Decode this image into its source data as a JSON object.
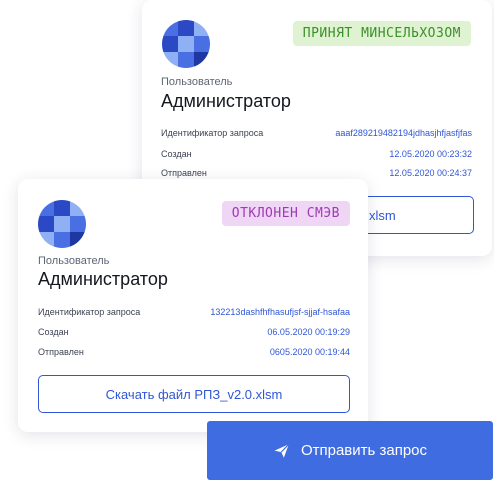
{
  "back_card": {
    "status_badge": "ПРИНЯТ МИНСЕЛЬХОЗОМ",
    "user_label": "Пользователь",
    "user_name": "Администратор",
    "rows": [
      {
        "label": "Идентификатор запроса",
        "value": "aaaf289219482194jdhasjhfjasfjfas"
      },
      {
        "label": "Создан",
        "value": "12.05.2020 00:23:32"
      },
      {
        "label": "Отправлен",
        "value": "12.05.2020 00:24:37"
      }
    ],
    "download_label_partial": "xlsm"
  },
  "front_card": {
    "status_badge": "ОТКЛОНЕН СМЭВ",
    "user_label": "Пользователь",
    "user_name": "Администратор",
    "rows": [
      {
        "label": "Идентификатор запроса",
        "value": "132213dashfhfhasufjsf-sjjaf-hsafaa"
      },
      {
        "label": "Создан",
        "value": "06.05.2020 00:19:29"
      },
      {
        "label": "Отправлен",
        "value": "0605.2020 00:19:44"
      }
    ],
    "download_label": "Скачать файл РПЗ_v2.0.xlsm"
  },
  "send_button": {
    "label": "Отправить запрос",
    "icon": "paper-plane-icon"
  },
  "colors": {
    "accent": "#2f56d6",
    "send_button": "#3f6ce0",
    "badge_accepted_bg": "#dff3d2",
    "badge_accepted_text": "#3c8f2a",
    "badge_rejected_bg": "#f0d6f5",
    "badge_rejected_text": "#9d3bb4"
  }
}
